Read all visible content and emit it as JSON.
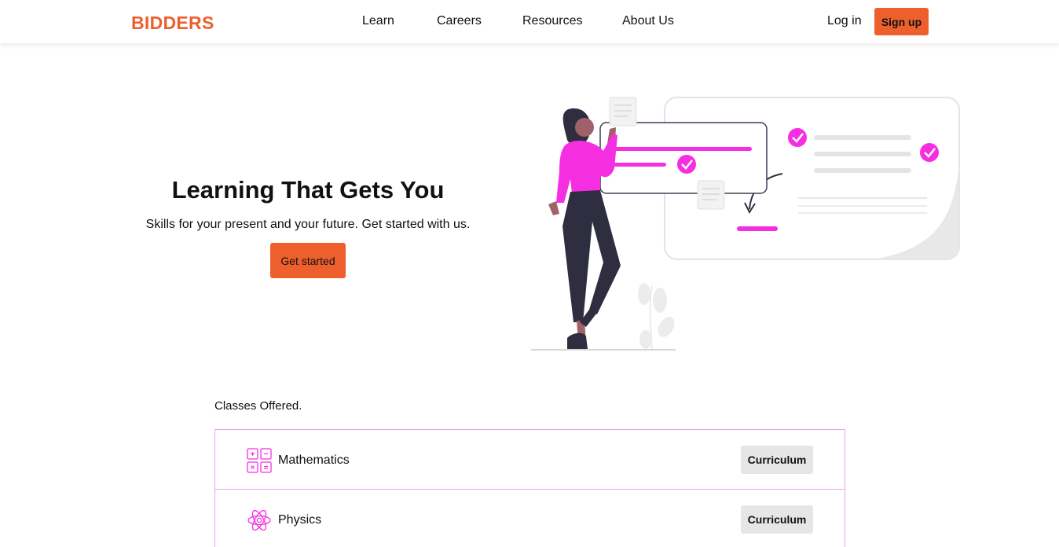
{
  "nav": {
    "logo": "BIDDERS",
    "links": [
      "Learn",
      "Careers",
      "Resources",
      "About Us"
    ],
    "login": "Log in",
    "signup": "Sign up"
  },
  "hero": {
    "title": "Learning That Gets You",
    "subtitle": "Skills for your present and your future. Get started with us.",
    "cta": "Get started"
  },
  "classes": {
    "label": "Classes Offered.",
    "items": [
      {
        "name": "Mathematics",
        "icon": "calculator-icon",
        "button": "Curriculum"
      },
      {
        "name": "Physics",
        "icon": "atom-icon",
        "button": "Curriculum"
      }
    ]
  },
  "colors": {
    "brand": "#ee5f2e",
    "accent": "#f62ee2",
    "border": "#e9a3e6",
    "button_gray": "#e6e6e6"
  }
}
